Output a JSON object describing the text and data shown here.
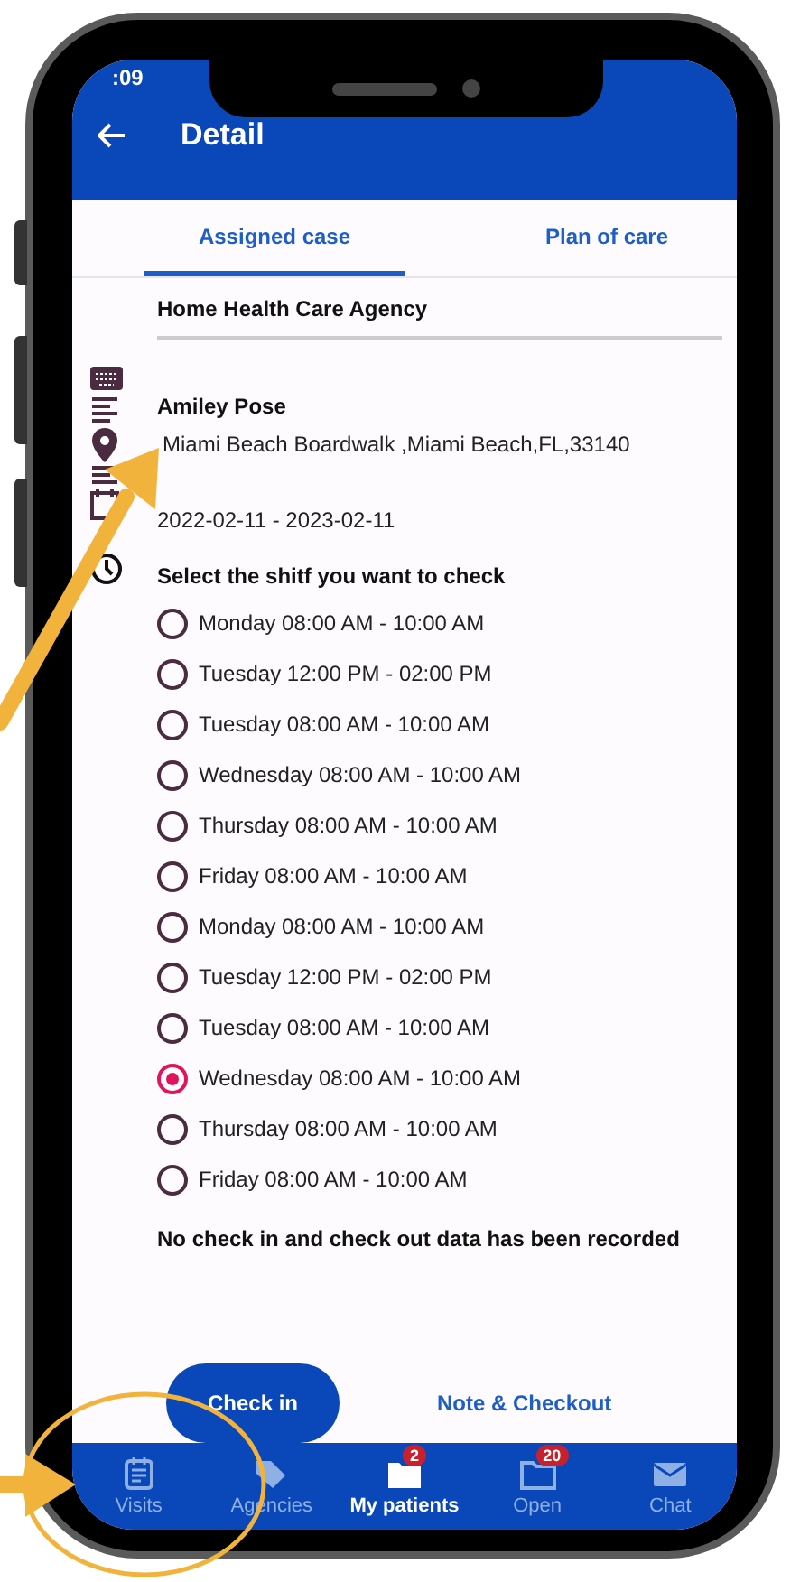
{
  "status_bar": {
    "time": ":09"
  },
  "header": {
    "title": "Detail"
  },
  "tabs": [
    {
      "label": "Assigned case",
      "selected": true
    },
    {
      "label": "Plan of care",
      "selected": false
    }
  ],
  "agency": "Home Health Care Agency",
  "patient": {
    "name": "Amiley  Pose",
    "address": "Miami Beach Boardwalk ,Miami Beach,FL,33140",
    "dates": "2022-02-11 - 2023-02-11"
  },
  "shift_prompt": "Select the shitf you want to check",
  "shifts": [
    {
      "label": "Monday 08:00 AM - 10:00 AM",
      "selected": false
    },
    {
      "label": "Tuesday 12:00 PM - 02:00 PM",
      "selected": false
    },
    {
      "label": "Tuesday 08:00 AM - 10:00 AM",
      "selected": false
    },
    {
      "label": "Wednesday 08:00 AM - 10:00 AM",
      "selected": false
    },
    {
      "label": "Thursday 08:00 AM - 10:00 AM",
      "selected": false
    },
    {
      "label": "Friday 08:00 AM - 10:00 AM",
      "selected": false
    },
    {
      "label": "Monday 08:00 AM - 10:00 AM",
      "selected": false
    },
    {
      "label": "Tuesday 12:00 PM - 02:00 PM",
      "selected": false
    },
    {
      "label": "Tuesday 08:00 AM - 10:00 AM",
      "selected": false
    },
    {
      "label": "Wednesday 08:00 AM - 10:00 AM",
      "selected": true
    },
    {
      "label": "Thursday 08:00 AM - 10:00 AM",
      "selected": false
    },
    {
      "label": "Friday 08:00 AM - 10:00 AM",
      "selected": false
    }
  ],
  "notice": "No check in and check out data has been recorded",
  "actions": {
    "primary": "Check in",
    "secondary": "Note & Checkout"
  },
  "bottom_nav": [
    {
      "kind": "visits",
      "label": "Visits",
      "selected": false
    },
    {
      "kind": "agencies",
      "label": "Agencies",
      "selected": false
    },
    {
      "kind": "patients",
      "label": "My patients",
      "selected": true,
      "badge": "2"
    },
    {
      "kind": "open",
      "label": "Open",
      "selected": false,
      "badge": "20"
    },
    {
      "kind": "chat",
      "label": "Chat",
      "selected": false
    }
  ]
}
